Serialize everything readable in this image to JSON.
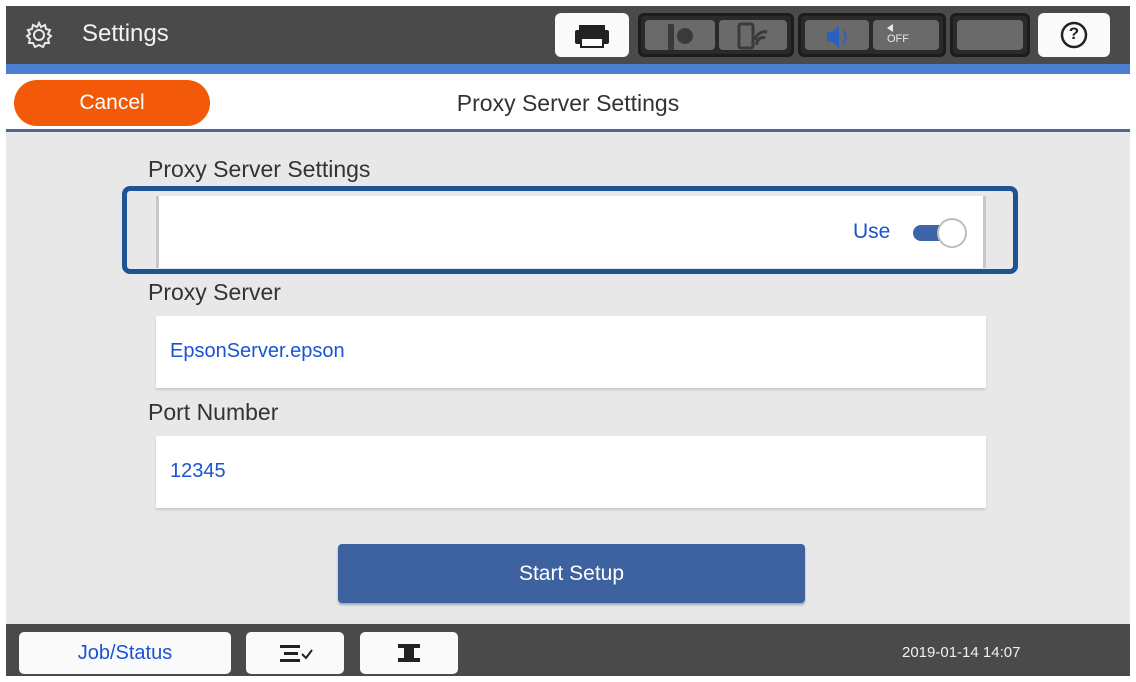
{
  "topbar": {
    "title": "Settings",
    "icons": [
      "gear-icon",
      "printer-icon",
      "wifi-direct-icon",
      "wifi-icon",
      "speaker-icon",
      "mute-icon",
      "sleep-icon",
      "help-icon"
    ],
    "help_glyph": "?"
  },
  "header": {
    "cancel_label": "Cancel",
    "title": "Proxy Server Settings"
  },
  "form": {
    "proxy_settings_label": "Proxy Server Settings",
    "use_label": "Use",
    "use_enabled": true,
    "proxy_server_label": "Proxy Server",
    "proxy_server_value": "EpsonServer.epson",
    "port_label": "Port Number",
    "port_value": "12345",
    "start_label": "Start Setup"
  },
  "bottombar": {
    "job_status_label": "Job/Status",
    "datetime": "2019-01-14 14:07"
  },
  "colors": {
    "accent": "#3e62a0",
    "cancel": "#f25a0a",
    "value_text": "#1a52d6",
    "topbar": "#4a4a4a"
  }
}
